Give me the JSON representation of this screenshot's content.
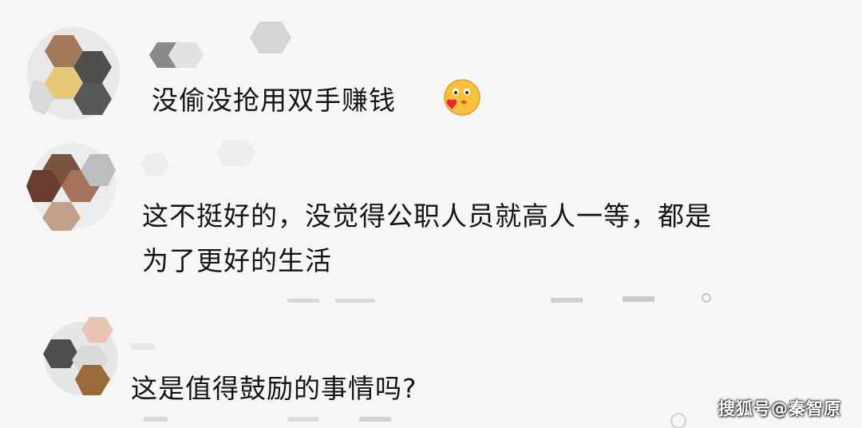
{
  "comments": [
    {
      "text": "没偷没抢用双手赚钱",
      "emoji": "smiling-face-with-heart-emoji"
    },
    {
      "text_line1": "这不挺好的，没觉得公职人员就高人一等，都是",
      "text_line2": "为了更好的生活"
    },
    {
      "text": "这是值得鼓励的事情吗?"
    }
  ],
  "watermark": {
    "text": "搜狐号@秦智原"
  },
  "colors": {
    "background": "#f6f6f6",
    "text": "#141414",
    "mosaic_tan": "#9a7a5a",
    "mosaic_dark": "#4a4a48"
  }
}
